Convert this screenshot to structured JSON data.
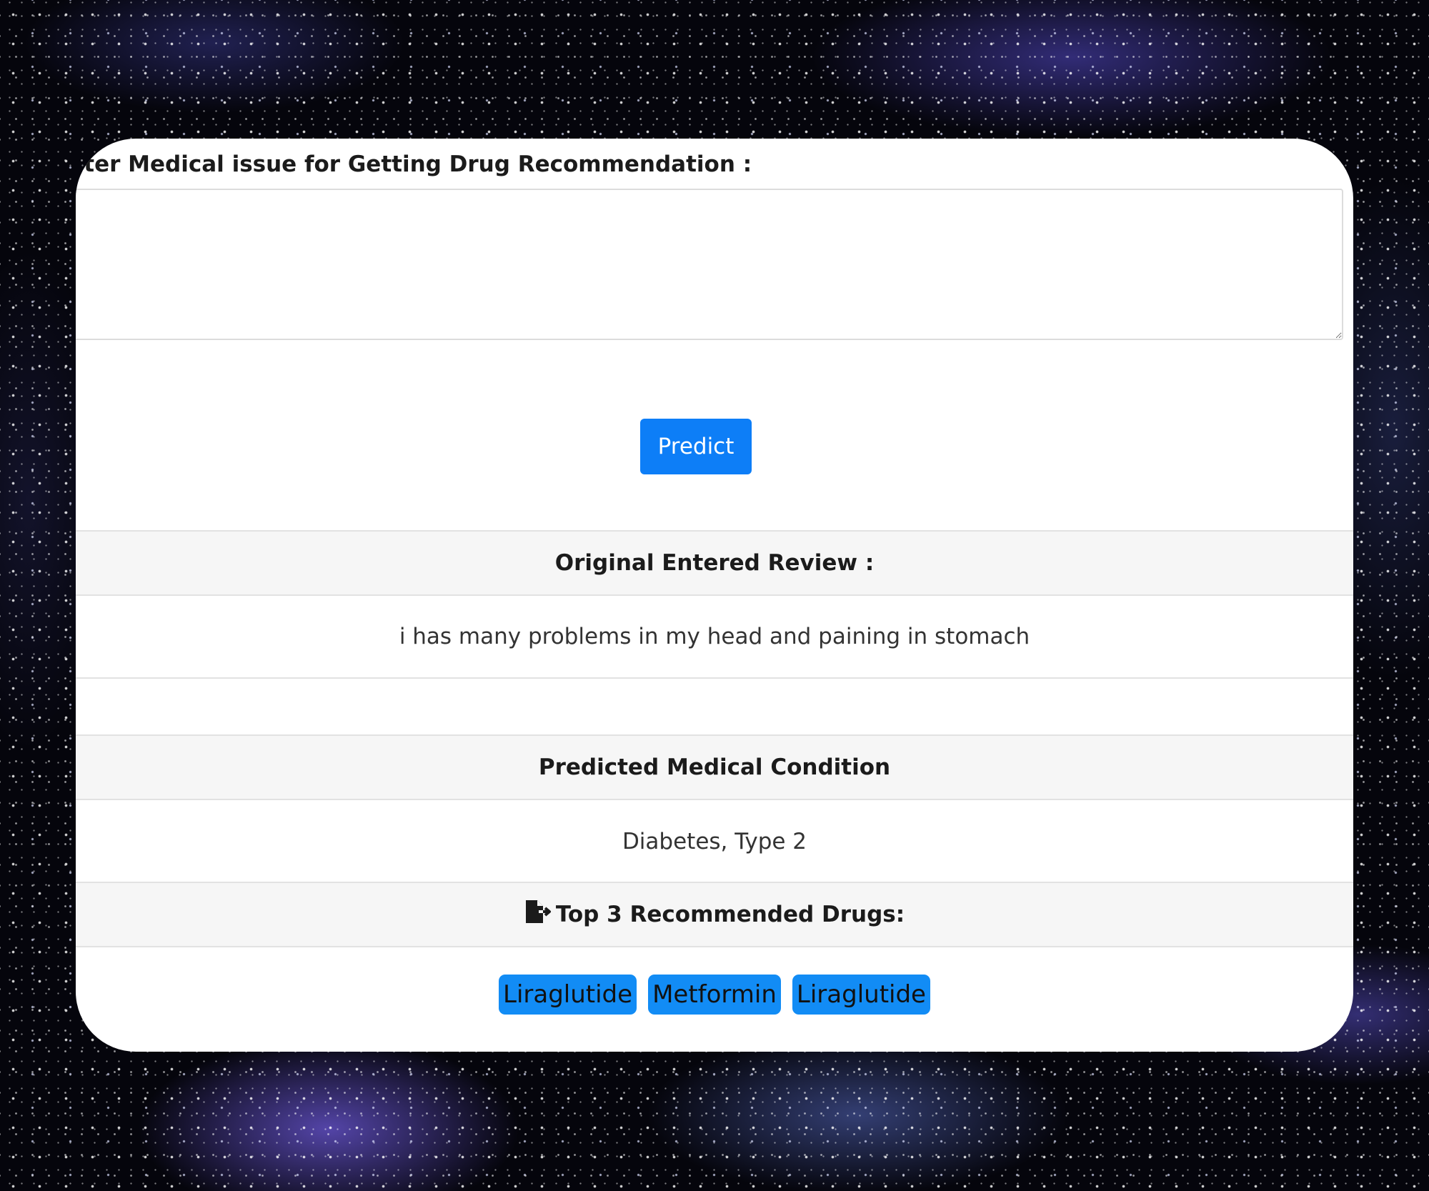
{
  "form": {
    "prompt_label": "Enter Medical issue for Getting Drug Recommendation :",
    "textarea_value": "",
    "predict_label": "Predict"
  },
  "review": {
    "header": "Original Entered Review :",
    "text": "i has many problems in my head and paining in stomach"
  },
  "condition": {
    "header": "Predicted Medical Condition",
    "value": "Diabetes, Type 2"
  },
  "drugs": {
    "header": "Top 3 Recommended Drugs:",
    "header_icon": "file-export-icon",
    "items": [
      "Liraglutide",
      "Metformin",
      "Liraglutide"
    ]
  },
  "colors": {
    "primary_button": "#0d7ef7",
    "drug_badge": "#128cf5",
    "section_header_bg": "#f6f6f6"
  }
}
